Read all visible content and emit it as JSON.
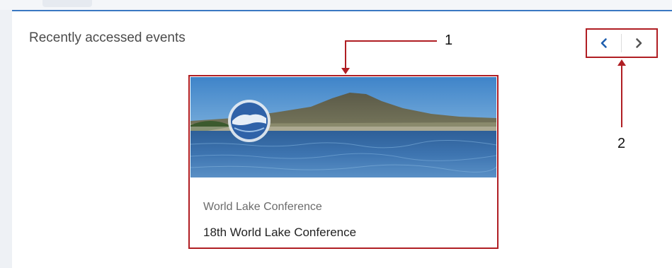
{
  "section": {
    "title": "Recently accessed events"
  },
  "carousel": {
    "prev_icon": "chevron-left-icon",
    "next_icon": "chevron-right-icon"
  },
  "event_card": {
    "category": "World Lake Conference",
    "title": "18th World Lake Conference",
    "image": "lake-and-mountain-photo"
  },
  "annotations": {
    "label_1": "1",
    "label_2": "2",
    "color": "#b01e23"
  },
  "colors": {
    "accent_border": "#3a78c2",
    "prev_arrow": "#1f5fae",
    "next_arrow": "#555555"
  }
}
